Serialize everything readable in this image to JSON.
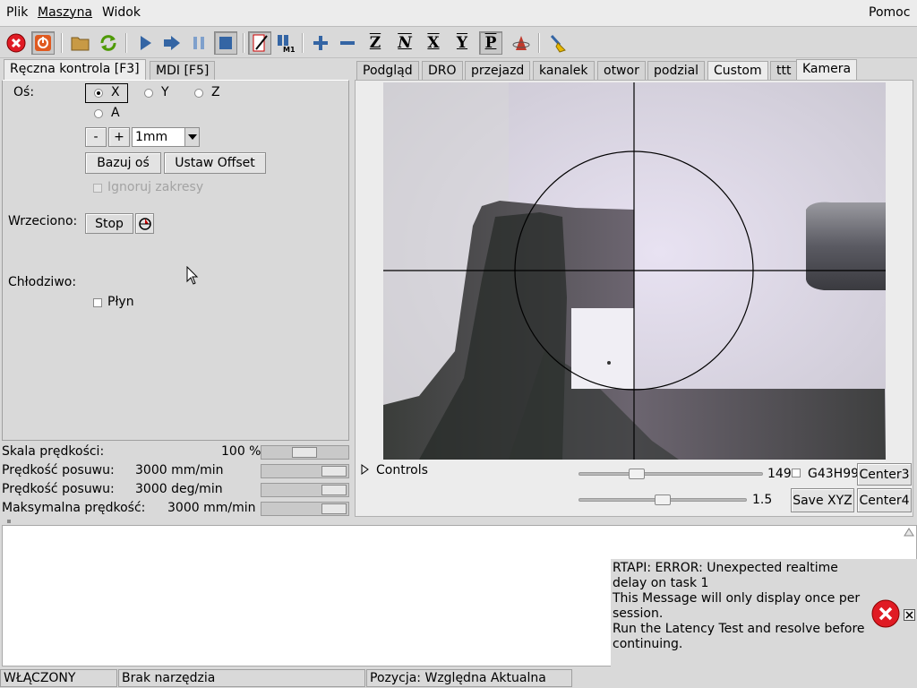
{
  "menubar": {
    "items": [
      "Plik",
      "Maszyna",
      "Widok"
    ],
    "help": "Pomoc"
  },
  "toolbar": {
    "axis_icons": [
      "Z",
      "N",
      "X",
      "Y",
      "P"
    ]
  },
  "left_tabs": [
    "Ręczna kontrola [F3]",
    "MDI [F5]"
  ],
  "manual": {
    "axis_label": "Oś:",
    "axes": [
      "X",
      "Y",
      "Z",
      "A"
    ],
    "selected_axis": "X",
    "minus": "-",
    "plus": "+",
    "increment": "1mm",
    "home_axis": "Bazuj oś",
    "set_offset": "Ustaw Offset",
    "ignore_limits": "Ignoruj zakresy",
    "spindle_label": "Wrzeciono:",
    "spindle_stop": "Stop",
    "coolant_label": "Chłodziwo:",
    "flood": "Płyn"
  },
  "overrides": [
    {
      "label": "Skala prędkości:",
      "value": "100 %",
      "level": 0.5
    },
    {
      "label": "Prędkość posuwu:",
      "value": "3000 mm/min",
      "level": 1.0
    },
    {
      "label": "Prędkość posuwu:",
      "value": "3000 deg/min",
      "level": 1.0
    },
    {
      "label": "Maksymalna prędkość:",
      "value": "3000 mm/min",
      "level": 1.0
    }
  ],
  "right_tabs": [
    "Podgląd",
    "DRO",
    "przejazd",
    "kanalek",
    "otwor",
    "podzial",
    "Custom",
    "ttt",
    "Kamera"
  ],
  "camera": {
    "controls_label": "Controls",
    "slider1_value": "149",
    "slider2_value": "1.5",
    "g43_label": "G43H99",
    "center3": "Center3",
    "center4": "Center4",
    "save_xyz": "Save XYZ"
  },
  "message": {
    "lines": [
      "RTAPI: ERROR: Unexpected realtime",
      "delay on task 1",
      "This Message will only display once per",
      "session.",
      "Run the Latency Test and resolve before",
      "continuing."
    ]
  },
  "status": {
    "machine": "WŁĄCZONY",
    "tool": "Brak narzędzia",
    "position": "Pozycja: Względna Aktualna"
  },
  "colors": {
    "error_red": "#e01b24",
    "play_blue": "#3465a4",
    "refresh_green": "#4e9a06"
  }
}
